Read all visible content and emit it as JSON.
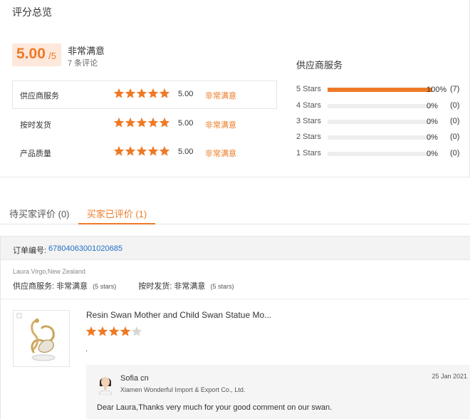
{
  "overview": {
    "title": "评分总览",
    "score": "5.00",
    "score_suffix": "/5",
    "summary_word": "非常满意",
    "review_count": "7 条评论",
    "metrics": [
      {
        "label": "供应商服务",
        "stars": 5,
        "score": "5.00",
        "word": "非常满意"
      },
      {
        "label": "按时发货",
        "stars": 5,
        "score": "5.00",
        "word": "非常满意"
      },
      {
        "label": "产品质量",
        "stars": 5,
        "score": "5.00",
        "word": "非常满意"
      }
    ],
    "service_title": "供应商服务",
    "star_breakdown": [
      {
        "label": "5 Stars",
        "fraction": 1.0,
        "pct": "100%",
        "count": "(7)"
      },
      {
        "label": "4 Stars",
        "fraction": 0.0,
        "pct": "0%",
        "count": "(0)"
      },
      {
        "label": "3 Stars",
        "fraction": 0.0,
        "pct": "0%",
        "count": "(0)"
      },
      {
        "label": "2 Stars",
        "fraction": 0.0,
        "pct": "0%",
        "count": "(0)"
      },
      {
        "label": "1 Stars",
        "fraction": 0.0,
        "pct": "0%",
        "count": "(0)"
      }
    ]
  },
  "tabs": {
    "pending": "待买家评价 (0)",
    "done": "买家已评价 (1)"
  },
  "order": {
    "label": "订单编号:",
    "number": "67804063001020685",
    "buyer_location": "Laura Virgo,New Zealand",
    "supplier_service_label": "供应商服务: 非常满意",
    "supplier_service_stars": "(5 stars)",
    "delivery_label": "按时发货: 非常满意",
    "delivery_stars": "(5 stars)",
    "product_title": "Resin Swan Mother and Child Swan Statue Mo...",
    "product_rating": 4,
    "product_comment": ".",
    "reply": {
      "name": "Sofia cn",
      "company": "Xiamen Wonderful Import & Export Co., Ltd.",
      "date": "25 Jan 2021",
      "text": "Dear Laura,Thanks very much for your good comment on our swan."
    }
  },
  "colors": {
    "accent": "#ee7a26",
    "link": "#1f6fc5",
    "inactive_star": "#d6d6d6"
  }
}
